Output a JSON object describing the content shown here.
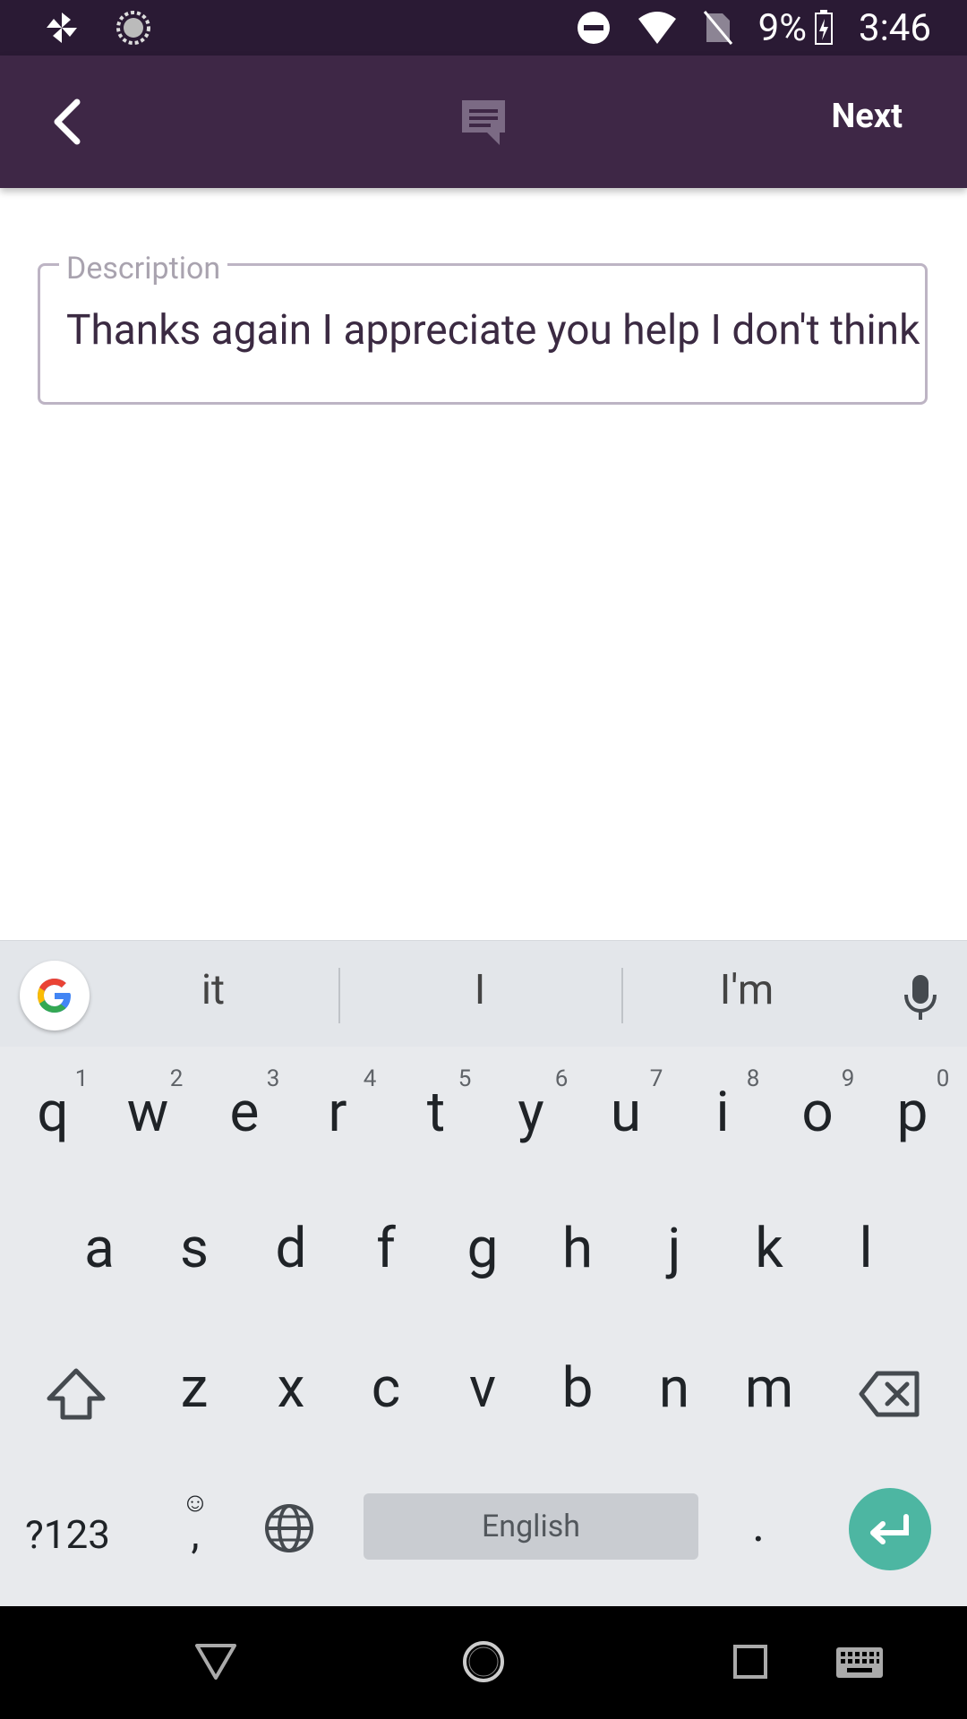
{
  "status_bar": {
    "battery": "9%",
    "time": "3:46"
  },
  "app_bar": {
    "next_label": "Next"
  },
  "description": {
    "label": "Description",
    "value": "Thanks again I appreciate you help I don't think"
  },
  "keyboard": {
    "suggestions": [
      "it",
      "I",
      "I'm"
    ],
    "row1": [
      "q",
      "w",
      "e",
      "r",
      "t",
      "y",
      "u",
      "i",
      "o",
      "p"
    ],
    "row1_numbers": [
      "1",
      "2",
      "3",
      "4",
      "5",
      "6",
      "7",
      "8",
      "9",
      "0"
    ],
    "row2": [
      "a",
      "s",
      "d",
      "f",
      "g",
      "h",
      "j",
      "k",
      "l"
    ],
    "row3": [
      "z",
      "x",
      "c",
      "v",
      "b",
      "n",
      "m"
    ],
    "symbols_label": "?123",
    "emoji_glyph": "☺",
    "comma_label": ",",
    "space_label": "English",
    "period_label": ".",
    "accent_color": "#4db6a2"
  },
  "colors": {
    "app_bar": "#3e2746",
    "status_bar": "#2a1a34"
  }
}
